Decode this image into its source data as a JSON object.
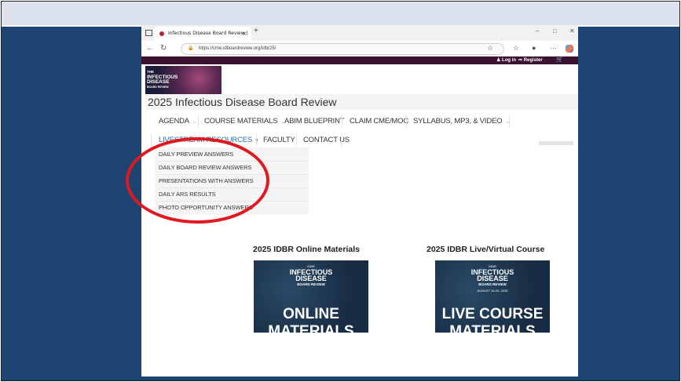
{
  "browser": {
    "tab_title": "Infectious Disease Board Review |",
    "tab_close": "×",
    "new_tab": "+",
    "window_controls": {
      "minimize": "–",
      "maximize": "□",
      "close": "✕"
    },
    "url": "https://cme.idboardreview.org/idbr25/"
  },
  "site": {
    "top_bar": {
      "login": "Log in",
      "register": "Register"
    },
    "logo": {
      "line1": "THE",
      "line2": "INFECTIOUS DISEASE",
      "line3": "BOARD REVIEW"
    },
    "title": "2025 Infectious Disease Board Review",
    "nav": {
      "agenda": "AGENDA",
      "course_materials": "COURSE MATERIALS",
      "abim_blueprint": "ABIM BLUEPRINT",
      "claim_cme": "CLAIM CME/MOC",
      "syllabus": "SYLLABUS, MP3, & VIDEO",
      "livestream": "LIVESTREAM RESOURCES",
      "faculty": "FACULTY",
      "contact": "CONTACT US"
    },
    "dropdown": [
      "DAILY PREVIEW ANSWERS",
      "DAILY BOARD REVIEW ANSWERS",
      "PRESENTATIONS WITH ANSWERS",
      "DAILY ARS RESULTS",
      "PHOTO OPPORTUNITY ANSWERS"
    ],
    "online": {
      "heading": "2025 IDBR Online Materials",
      "small": "IDBR",
      "b1": "INFECTIOUS",
      "b2": "DISEASE",
      "b3": "BOARD REVIEW",
      "big1": "ONLINE",
      "big2": "MATERIALS"
    },
    "live": {
      "heading": "2025 IDBR Live/Virtual Course",
      "small": "IDBR",
      "b1": "INFECTIOUS",
      "b2": "DISEASE",
      "b3": "BOARD REVIEW",
      "dates": "AUGUST 16-20, 2025",
      "big1": "LIVE COURSE",
      "big2": "MATERIALS"
    }
  },
  "colors": {
    "slide_bg": "#1e4472",
    "site_top_bar": "#3a1230",
    "nav_active": "#2a6aa0",
    "annotation_circle": "#e0191e"
  }
}
